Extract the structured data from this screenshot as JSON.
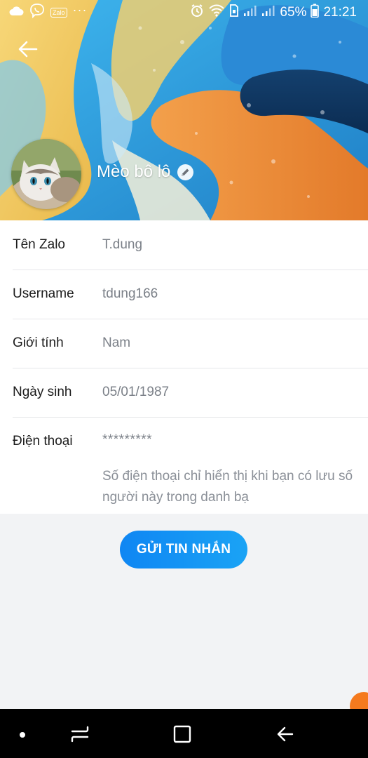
{
  "status_bar": {
    "zalo_label": "Zalo",
    "more": "···",
    "battery_percent": "65%",
    "time": "21:21"
  },
  "profile": {
    "display_name": "Mèo bô lô"
  },
  "info": {
    "rows": [
      {
        "label": "Tên Zalo",
        "value": "T.dung"
      },
      {
        "label": "Username",
        "value": "tdung166"
      },
      {
        "label": "Giới tính",
        "value": "Nam"
      },
      {
        "label": "Ngày sinh",
        "value": "05/01/1987"
      }
    ],
    "phone": {
      "label": "Điện thoại",
      "value": "*********",
      "note": "Số điện thoại chỉ hiển thị khi bạn có lưu số người này trong danh bạ"
    }
  },
  "actions": {
    "send_message": "GỬI TIN NHẮN"
  },
  "colors": {
    "accent": "#1296f0",
    "label_text": "#1c1c1c",
    "value_text": "#7b8088",
    "page_bg": "#f2f3f5"
  },
  "icons": {
    "back": "back-arrow-icon",
    "edit": "pencil-icon",
    "nav_home": "home-dot-icon",
    "nav_recents": "recents-icon",
    "nav_overview": "overview-square-icon",
    "nav_back": "nav-back-icon"
  }
}
